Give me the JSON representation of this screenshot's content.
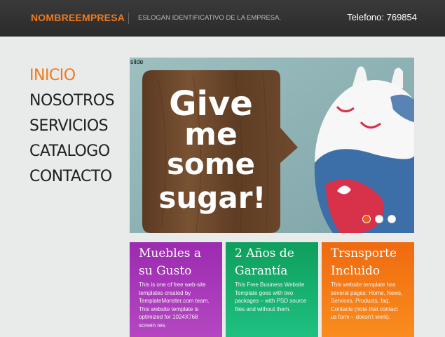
{
  "header": {
    "brand": "NOMBREEMPRESA",
    "slogan": "ESLOGAN IDENTIFICATIVO DE LA EMPRESA.",
    "phone": "Telefono: 769854"
  },
  "nav": {
    "items": [
      {
        "label": "INICIO",
        "active": true
      },
      {
        "label": "NOSOTROS",
        "active": false
      },
      {
        "label": "SERVICIOS",
        "active": false
      },
      {
        "label": "CATALOGO",
        "active": false
      },
      {
        "label": "CONTACTO",
        "active": false
      }
    ]
  },
  "slider": {
    "alt_label": "slide",
    "sign_lines": [
      "Give",
      "me",
      "some",
      "sugar!"
    ],
    "dot_count": 3,
    "active_dot": 0
  },
  "boxes": [
    {
      "title_line1": "Muebles a",
      "title_line2": "su Gusto",
      "text": "This is one of free web-site templates created by TemplateMonster.com team. This website template is optimized for 1024X768 screen res."
    },
    {
      "title_line1": "2 Años de",
      "title_line2": "Garantía",
      "text": "This Free Business Website Template goes with two packages – with PSD source files and without them."
    },
    {
      "title_line1": "Trsnsporte",
      "title_line2": "Incluido",
      "text": "This website template has several pages: Home, News, Services, Products, faq, Contacts (note that contact us form – doesn't work)."
    }
  ],
  "colors": {
    "accent": "#f07a1c",
    "box_purple": "#a636b8",
    "box_green": "#17b070",
    "box_orange": "#f57c16",
    "dot_active": "#f05a1a"
  }
}
